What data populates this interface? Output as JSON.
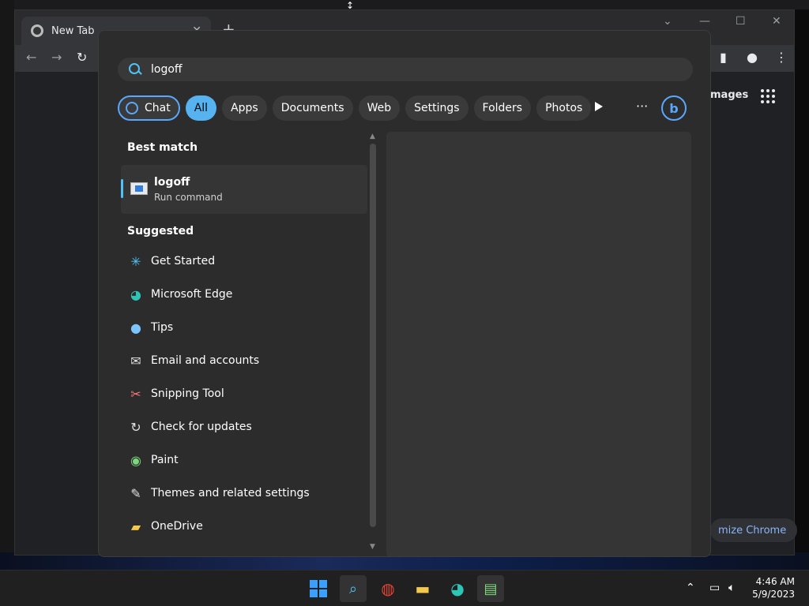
{
  "chrome": {
    "tab_title": "New Tab",
    "images_label": "mages",
    "customize_label": "mize Chrome"
  },
  "search": {
    "query": "logoff",
    "filters": [
      "Chat",
      "All",
      "Apps",
      "Documents",
      "Web",
      "Settings",
      "Folders",
      "Photos"
    ],
    "active_filter": "All",
    "more_label": "···",
    "best_match_title": "Best match",
    "best_match": {
      "name": "logoff",
      "type": "Run command"
    },
    "suggested_title": "Suggested",
    "suggested": [
      {
        "label": "Get Started",
        "icon": "get-started-icon"
      },
      {
        "label": "Microsoft Edge",
        "icon": "edge-icon"
      },
      {
        "label": "Tips",
        "icon": "tips-bulb-icon"
      },
      {
        "label": "Email and accounts",
        "icon": "mail-icon"
      },
      {
        "label": "Snipping Tool",
        "icon": "snipping-tool-icon"
      },
      {
        "label": "Check for updates",
        "icon": "refresh-icon"
      },
      {
        "label": "Paint",
        "icon": "paint-icon"
      },
      {
        "label": "Themes and related settings",
        "icon": "brush-icon"
      },
      {
        "label": "OneDrive",
        "icon": "onedrive-icon"
      }
    ]
  },
  "taskbar": {
    "time": "4:46 AM",
    "date": "5/9/2023"
  },
  "colors": {
    "accent": "#57b3f0",
    "panel": "#2c2c2c"
  }
}
